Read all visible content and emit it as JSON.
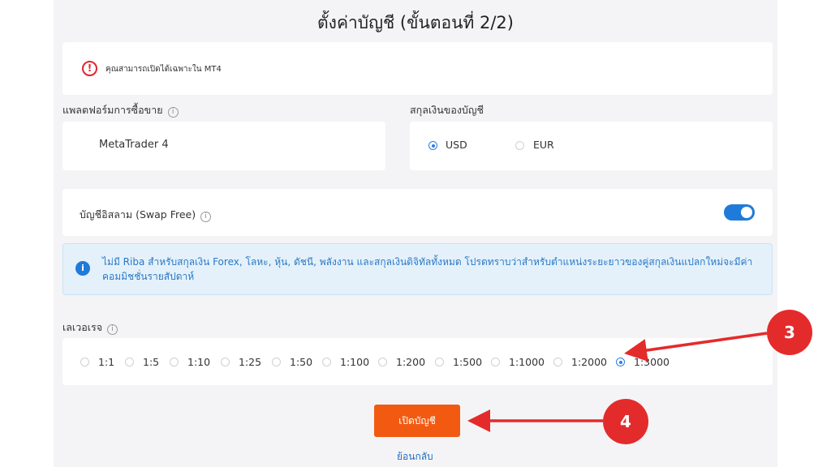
{
  "page": {
    "title": "ตั้งค่าบัญชี (ขั้นตอนที่ 2/2)"
  },
  "alert": {
    "icon": "exclamation-circle-icon",
    "text": "คุณสามารถเปิดได้เฉพาะใน MT4"
  },
  "platform": {
    "label": "แพลตฟอร์มการซื้อขาย",
    "value": "MetaTrader 4"
  },
  "currency": {
    "label": "สกุลเงินของบัญชี",
    "options": [
      {
        "label": "USD",
        "selected": true
      },
      {
        "label": "EUR",
        "selected": false
      }
    ]
  },
  "swap_free": {
    "label": "บัญชีอิสลาม (Swap Free)",
    "enabled": true
  },
  "notice": {
    "icon": "info-icon",
    "text": "ไม่มี Riba สำหรับสกุลเงิน Forex, โลหะ, หุ้น, ดัชนี, พลังงาน และสกุลเงินดิจิทัลทั้งหมด โปรดทราบว่าสำหรับตำแหน่งระยะยาวของคู่สกุลเงินแปลกใหม่จะมีค่าคอมมิชชั่นรายสัปดาห์"
  },
  "leverage": {
    "label": "เลเวอเรจ",
    "options": [
      {
        "label": "1:1",
        "selected": false
      },
      {
        "label": "1:5",
        "selected": false
      },
      {
        "label": "1:10",
        "selected": false
      },
      {
        "label": "1:25",
        "selected": false
      },
      {
        "label": "1:50",
        "selected": false
      },
      {
        "label": "1:100",
        "selected": false
      },
      {
        "label": "1:200",
        "selected": false
      },
      {
        "label": "1:500",
        "selected": false
      },
      {
        "label": "1:1000",
        "selected": false
      },
      {
        "label": "1:2000",
        "selected": false
      },
      {
        "label": "1:3000",
        "selected": true
      }
    ]
  },
  "actions": {
    "open_account": "เปิดบัญชี",
    "back": "ย้อนกลับ"
  },
  "annotations": {
    "step3": "3",
    "step4": "4",
    "color": "#e42b2b"
  },
  "colors": {
    "accent": "#1f7bd9",
    "button": "#f25a12",
    "panel": "#f4f4f6"
  }
}
